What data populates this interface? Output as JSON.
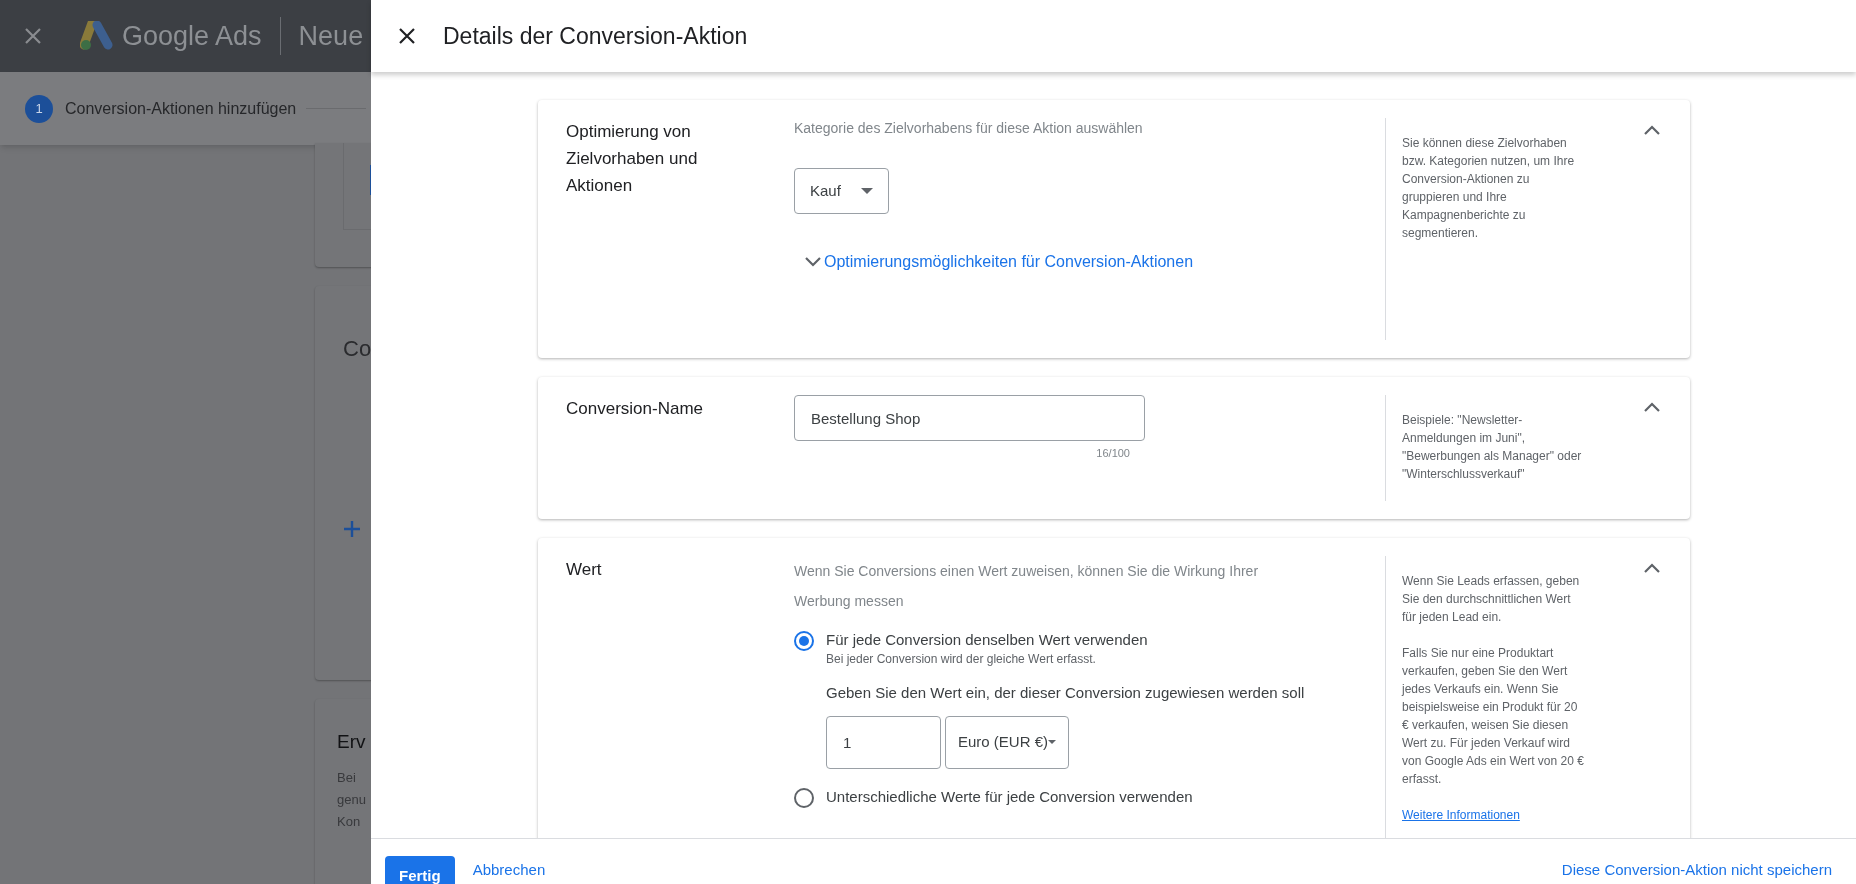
{
  "background": {
    "app_name": "Google Ads",
    "page_title": "Neue",
    "stepper": [
      {
        "number": "1",
        "label": "Conversion-Aktionen hinzufügen",
        "selected": true
      }
    ],
    "cards": [
      {
        "title": "Co"
      },
      {
        "title": "Erv",
        "lines": [
          "Bei",
          "genu",
          "Kon"
        ]
      }
    ]
  },
  "dialog": {
    "title": "Details der Conversion-Aktion",
    "sections": [
      {
        "kind": "category",
        "title": "Optimierung von Zielvorhaben und Aktionen",
        "expanded": true,
        "description": "Kategorie des Zielvorhabens für diese Aktion auswählen",
        "dropdown": {
          "value": "Kauf"
        },
        "link": "Optimierungsmöglichkeiten für Conversion-Aktionen",
        "help": [
          "Sie können diese Zielvorhaben bzw. Kategorien nutzen, um Ihre Conversion-Aktionen zu gruppieren und Ihre Kampagnenberichte zu segmentieren."
        ]
      },
      {
        "kind": "name",
        "title": "Conversion-Name",
        "expanded": true,
        "field": {
          "value": "Bestellung Shop",
          "counter": "16/100"
        },
        "help": [
          "Beispiele: \"Newsletter-Anmeldungen im Juni\", \"Bewerbungen als Manager\" oder \"Winterschlussverkauf\""
        ]
      },
      {
        "kind": "value",
        "title": "Wert",
        "expanded": true,
        "description": "Wenn Sie Conversions einen Wert zuweisen, können Sie die Wirkung Ihrer Werbung messen",
        "options": [
          {
            "label": "Für jede Conversion denselben Wert verwenden",
            "sublabel": "Bei jeder Conversion wird der gleiche Wert erfasst.",
            "selected": true
          },
          {
            "label": "Unterschiedliche Werte für jede Conversion verwenden",
            "selected": false
          }
        ],
        "prompt": "Geben Sie den Wert ein, der dieser Conversion zugewiesen werden soll",
        "amount": "1",
        "currency": "Euro (EUR €)",
        "help": [
          "Wenn Sie Leads erfassen, geben Sie den durchschnittlichen Wert für jeden Lead ein.",
          "Falls Sie nur eine Produktart verkaufen, geben Sie den Wert jedes Verkaufs ein. Wenn Sie beispielsweise ein Produkt für 20 € verkaufen, weisen Sie diesen Wert zu. Für jeden Verkauf wird von Google Ads ein Wert von 20 € erfasst."
        ],
        "help_link": "Weitere Informationen"
      }
    ],
    "footer": {
      "primary": "Fertig",
      "cancel": "Abbrechen",
      "discard": "Diese Conversion-Aktion nicht speichern"
    }
  }
}
